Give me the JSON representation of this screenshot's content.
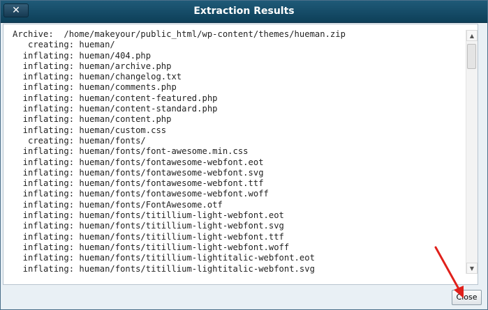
{
  "dialog": {
    "title": "Extraction Results",
    "close_icon_glyph": "✕",
    "close_button_label": "Close"
  },
  "log": {
    "lines": [
      "Archive:  /home/makeyour/public_html/wp-content/themes/hueman.zip",
      "   creating: hueman/",
      "  inflating: hueman/404.php",
      "  inflating: hueman/archive.php",
      "  inflating: hueman/changelog.txt",
      "  inflating: hueman/comments.php",
      "  inflating: hueman/content-featured.php",
      "  inflating: hueman/content-standard.php",
      "  inflating: hueman/content.php",
      "  inflating: hueman/custom.css",
      "   creating: hueman/fonts/",
      "  inflating: hueman/fonts/font-awesome.min.css",
      "  inflating: hueman/fonts/fontawesome-webfont.eot",
      "  inflating: hueman/fonts/fontawesome-webfont.svg",
      "  inflating: hueman/fonts/fontawesome-webfont.ttf",
      "  inflating: hueman/fonts/fontawesome-webfont.woff",
      "  inflating: hueman/fonts/FontAwesome.otf",
      "  inflating: hueman/fonts/titillium-light-webfont.eot",
      "  inflating: hueman/fonts/titillium-light-webfont.svg",
      "  inflating: hueman/fonts/titillium-light-webfont.ttf",
      "  inflating: hueman/fonts/titillium-light-webfont.woff",
      "  inflating: hueman/fonts/titillium-lightitalic-webfont.eot",
      "  inflating: hueman/fonts/titillium-lightitalic-webfont.svg"
    ]
  },
  "colors": {
    "titlebar": "#0d3f58",
    "arrow": "#e0201b"
  },
  "icons": {
    "close": "close-icon",
    "scroll_up": "chevron-up-icon",
    "scroll_down": "chevron-down-icon",
    "annotation": "red-arrow-icon"
  }
}
